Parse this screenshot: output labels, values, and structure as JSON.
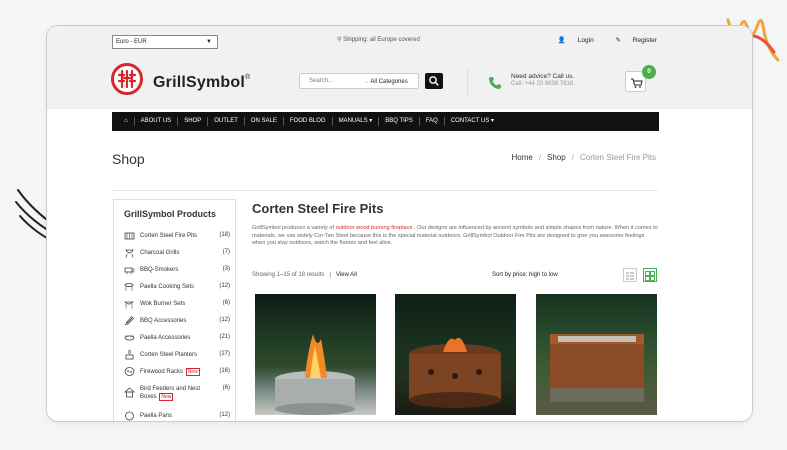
{
  "topbar": {
    "currency": "Euro - EUR",
    "shipping": "Shipping: all Europe covered",
    "login": "Login",
    "register": "Register"
  },
  "header": {
    "logo_text": "GrillSymbol",
    "logo_mark": "®",
    "search_placeholder": "Search...",
    "category_select": "All Categories",
    "advice_title": "Need advice? Call us.",
    "advice_phone": "Call: +44 20 8638 7816",
    "cart_count": "0"
  },
  "nav": {
    "items": [
      "ABOUT US",
      "SHOP",
      "OUTLET",
      "ON SALE",
      "FOOD BLOG",
      "MANUALS ▾",
      "BBQ TIPS",
      "FAQ",
      "CONTACT US ▾"
    ]
  },
  "page": {
    "title": "Shop",
    "breadcrumb": [
      "Home",
      "Shop",
      "Corten Steel Fire Pits"
    ]
  },
  "sidebar": {
    "title": "GrillSymbol Products",
    "items": [
      {
        "label": "Corten Steel Fire Pits",
        "count": "(18)"
      },
      {
        "label": "Charcoal Grills",
        "count": "(7)"
      },
      {
        "label": "BBQ-Smokers",
        "count": "(3)"
      },
      {
        "label": "Paella Cooking Sets",
        "count": "(12)"
      },
      {
        "label": "Wok Burner Sets",
        "count": "(6)"
      },
      {
        "label": "BBQ Accessories",
        "count": "(12)"
      },
      {
        "label": "Paella Accessories",
        "count": "(21)"
      },
      {
        "label": "Corten Steel Planters",
        "count": "(27)"
      },
      {
        "label": "Firewood Racks",
        "count": "(16)",
        "badge": "New"
      },
      {
        "label": "Bird Feeders and Nest",
        "label2": "Boxes",
        "count": "(6)",
        "badge": "New"
      },
      {
        "label": "Paella Pans",
        "count": "(12)"
      }
    ]
  },
  "main": {
    "title": "Corten Steel Fire Pits",
    "desc_1": "GrillSymbol produces a variety of ",
    "desc_link": "outdoor wood burning fireplace",
    "desc_2": " . Our designs are influenced by ancient symbols and simple shapes from nature. When it comes to materials, we use widely Cor-Ten Steel because this is the special material outdoors. GrillSymbol Outdoor Fire Pits are designed to give you awesome feelings when you stay outdoors, watch the flames and feel alive.",
    "showing": "Showing 1–15 of 18 results",
    "view_all": "View All",
    "sort": "Sort by price: high to low"
  }
}
